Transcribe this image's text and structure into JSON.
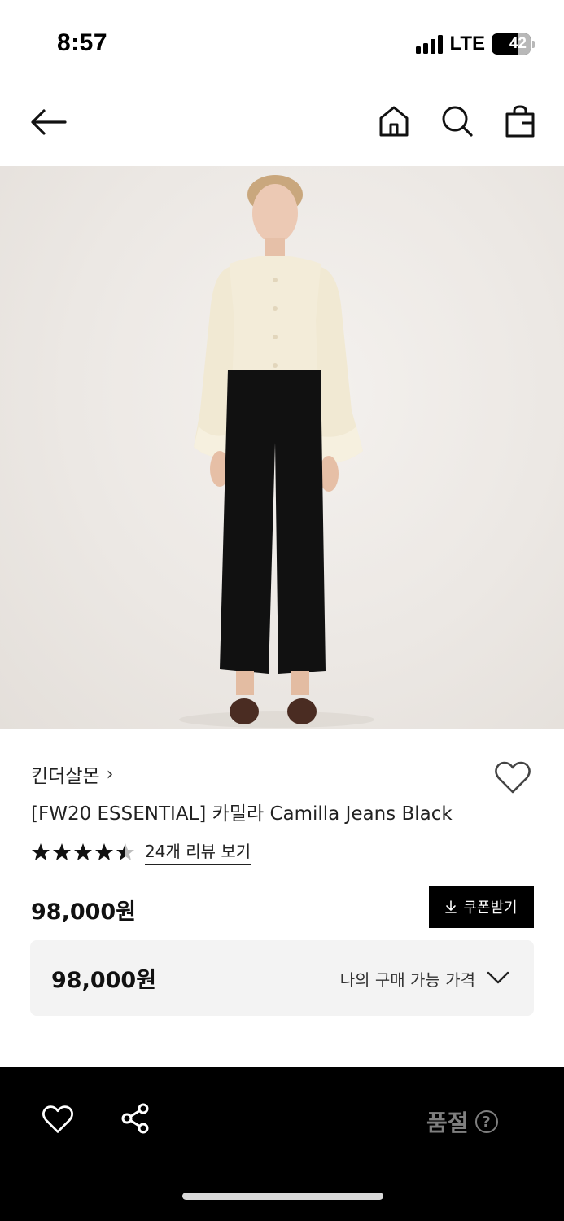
{
  "status": {
    "time": "8:57",
    "network": "LTE",
    "battery": "42"
  },
  "header": {
    "back_icon": "arrow-left-icon",
    "home_icon": "home-icon",
    "search_icon": "search-icon",
    "bag_icon": "shopping-bag-icon"
  },
  "product": {
    "brand": "킨더살몬",
    "brand_chevron": "›",
    "title": "[FW20 ESSENTIAL] 카밀라 Camilla Jeans Black",
    "rating": 4.5,
    "review_link": "24개 리뷰 보기",
    "price": "98,000원",
    "coupon_label": "쿠폰받기",
    "my_price": "98,000원",
    "my_price_label": "나의 구매 가능 가격"
  },
  "bottom_bar": {
    "status": "품절",
    "help_symbol": "?"
  },
  "colors": {
    "accent": "#000000",
    "soldout": "#7f7f7f",
    "box_bg": "#f3f3f3"
  }
}
